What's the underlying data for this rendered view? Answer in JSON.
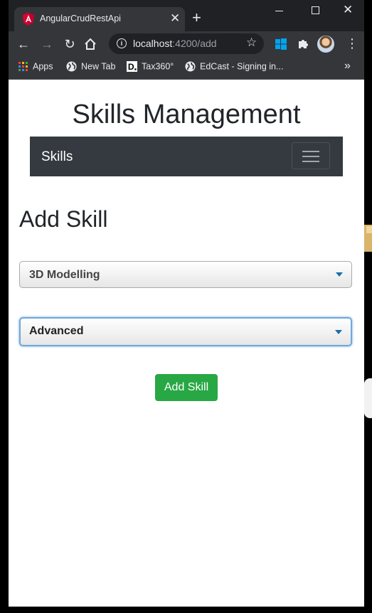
{
  "browser": {
    "tab_title": "AngularCrudRestApi",
    "tab_close": "✕",
    "new_tab": "+",
    "url_host": "localhost",
    "url_path": ":4200/add",
    "bookmarks": [
      {
        "label": "Apps",
        "icon": "apps-grid-icon"
      },
      {
        "label": "New Tab",
        "icon": "globe-icon"
      },
      {
        "label": "Tax360°",
        "icon": "d-logo-icon"
      },
      {
        "label": "EdCast - Signing in...",
        "icon": "globe-icon"
      }
    ]
  },
  "page": {
    "title": "Skills Management",
    "navbar_brand": "Skills",
    "heading": "Add Skill",
    "skill_select": {
      "value": "3D Modelling"
    },
    "level_select": {
      "value": "Advanced"
    },
    "submit_label": "Add Skill"
  },
  "colors": {
    "navbar": "#343a40",
    "button": "#28a745",
    "focus": "#6fa8dc",
    "caret": "#1a6ea8"
  }
}
